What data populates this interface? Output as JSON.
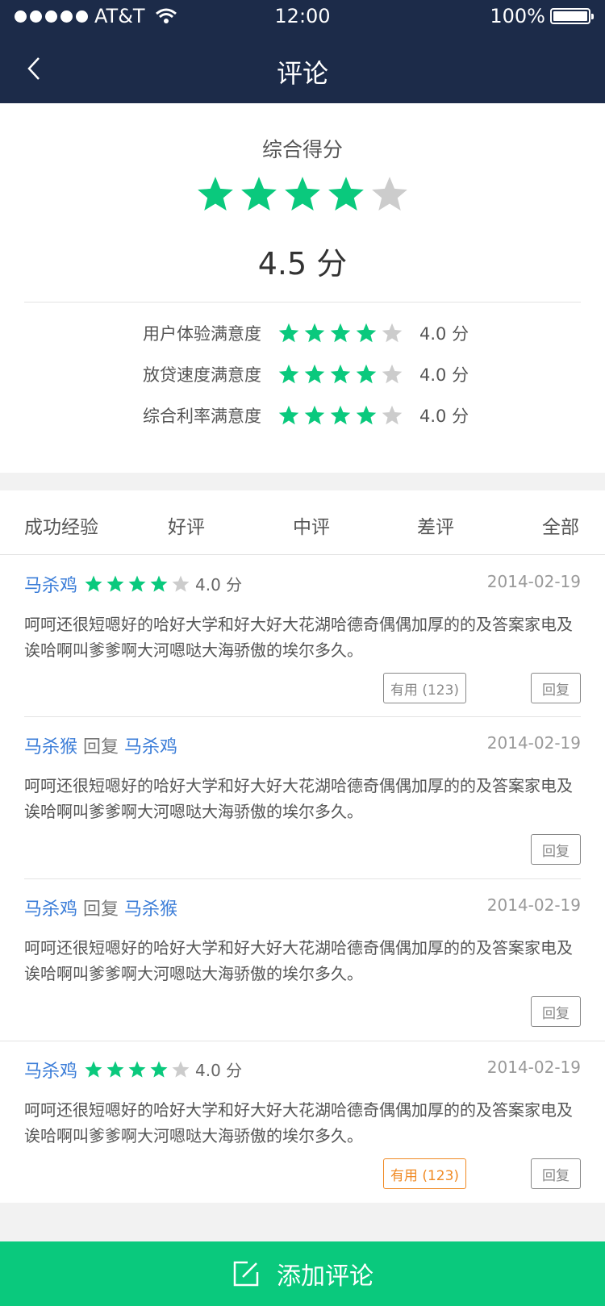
{
  "status_bar": {
    "carrier": "AT&T",
    "time": "12:00",
    "battery": "100%"
  },
  "nav": {
    "title": "评论"
  },
  "colors": {
    "star_on": "#0ac97d",
    "star_off": "#cccccc"
  },
  "summary": {
    "title": "综合得分",
    "rating": 4,
    "score_text": "4.5 分",
    "sub_ratings": [
      {
        "label": "用户体验满意度",
        "rating": 4,
        "score": "4.0 分"
      },
      {
        "label": "放贷速度满意度",
        "rating": 4,
        "score": "4.0 分"
      },
      {
        "label": "综合利率满意度",
        "rating": 4,
        "score": "4.0 分"
      }
    ]
  },
  "tabs": [
    "成功经验",
    "好评",
    "中评",
    "差评",
    "全部"
  ],
  "reviews": [
    {
      "author": "马杀鸡",
      "rating": 4,
      "score": "4.0 分",
      "date": "2014-02-19",
      "text": "呵呵还很短嗯好的哈好大学和好大好大花湖哈德奇偶偶加厚的的及答案家电及诶哈啊叫爹爹啊大河嗯哒大海骄傲的埃尔多久。",
      "useful": "有用 (123)",
      "reply": "回复"
    },
    {
      "author": "马杀猴",
      "reply_word": "回复",
      "reply_to": "马杀鸡",
      "date": "2014-02-19",
      "text": "呵呵还很短嗯好的哈好大学和好大好大花湖哈德奇偶偶加厚的的及答案家电及诶哈啊叫爹爹啊大河嗯哒大海骄傲的埃尔多久。",
      "reply": "回复"
    },
    {
      "author": "马杀鸡",
      "reply_word": "回复",
      "reply_to": "马杀猴",
      "date": "2014-02-19",
      "text": "呵呵还很短嗯好的哈好大学和好大好大花湖哈德奇偶偶加厚的的及答案家电及诶哈啊叫爹爹啊大河嗯哒大海骄傲的埃尔多久。",
      "reply": "回复"
    },
    {
      "author": "马杀鸡",
      "rating": 4,
      "score": "4.0 分",
      "date": "2014-02-19",
      "text": "呵呵还很短嗯好的哈好大学和好大好大花湖哈德奇偶偶加厚的的及答案家电及诶哈啊叫爹爹啊大河嗯哒大海骄傲的埃尔多久。",
      "useful": "有用 (123)",
      "reply": "回复"
    }
  ],
  "add_button": {
    "label": "添加评论",
    "icon": "edit-icon"
  }
}
